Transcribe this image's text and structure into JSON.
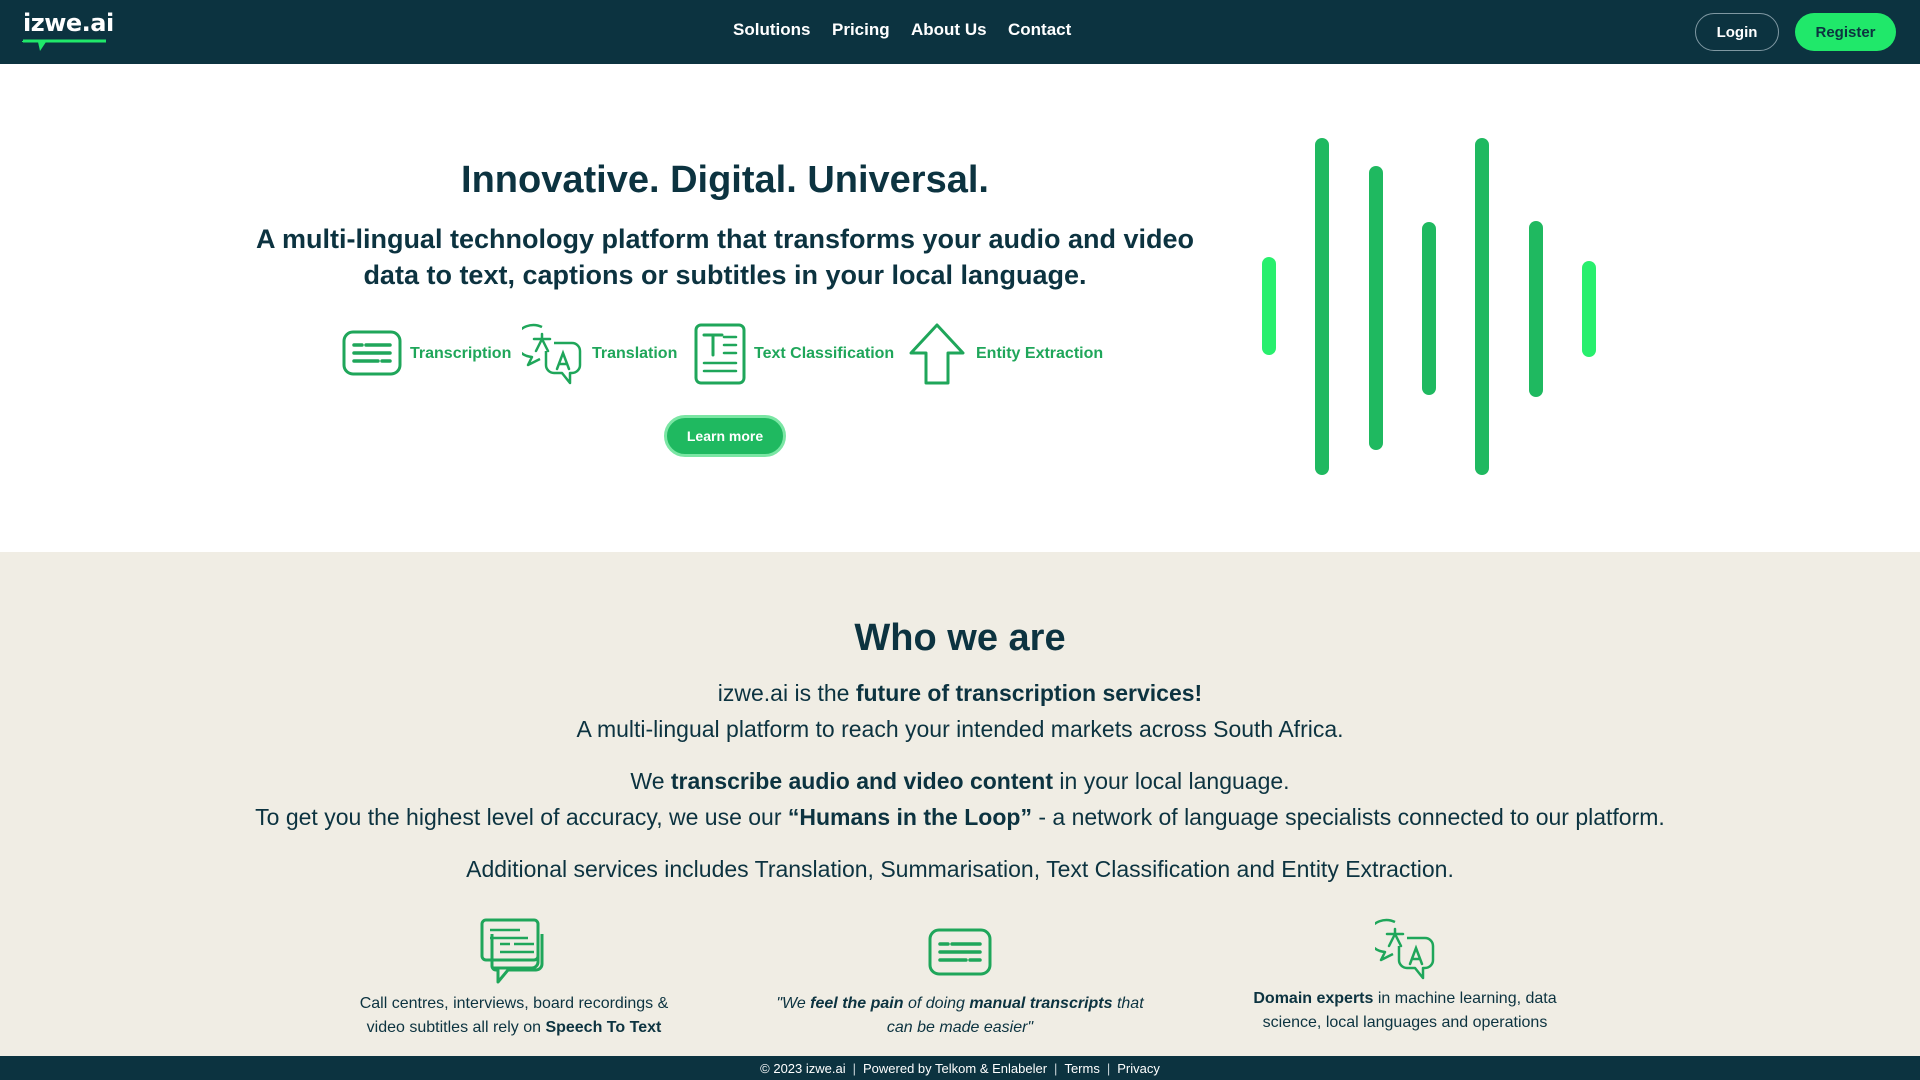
{
  "brand": {
    "logo_text": "izwe.ai",
    "accent": "#20e86a",
    "dark": "#0c3340"
  },
  "nav": {
    "solutions": "Solutions",
    "pricing": "Pricing",
    "about": "About Us",
    "contact": "Contact"
  },
  "auth": {
    "login": "Login",
    "register": "Register"
  },
  "hero": {
    "title": "Innovative. Digital. Universal.",
    "subtitle_line1": "A multi-lingual technology platform that transforms your audio and video",
    "subtitle_line2": "data to text, captions or subtitles in your local language.",
    "features": {
      "transcription": "Transcription",
      "translation": "Translation",
      "text_classification": "Text Classification",
      "entity_extraction": "Entity Extraction"
    },
    "learn_more": "Learn more"
  },
  "who": {
    "title": "Who we are",
    "p1a": "izwe.ai is the ",
    "p1b": "future of transcription services!",
    "p2": "A multi-lingual platform to reach your intended markets across South Africa.",
    "p3a": "We ",
    "p3b": "transcribe audio and video content",
    "p3c": " in your local language.",
    "p4a": "To get you the highest level of accuracy, we use our ",
    "p4b": "“Humans in the Loop”",
    "p4c": " - a network of language specialists connected to our platform.",
    "p5": "Additional services includes Translation, Summarisation, Text Classification and Entity Extraction.",
    "card1": {
      "line1": "Call centres, interviews, board recordings &",
      "line2a": "video subtitles all rely on ",
      "line2b": "Speech To Text"
    },
    "card2": {
      "q1a": "\"We ",
      "q1b": "feel the pain",
      "q1c": " of doing ",
      "q1d": "manual transcripts",
      "q1e": " that",
      "q2": "can be made easier\""
    },
    "card3": {
      "line1a": "Domain experts",
      "line1b": " in machine learning, data",
      "line2": "science, local languages and operations"
    }
  },
  "footer": {
    "copyright": "© 2023 izwe.ai",
    "powered": "Powered by Telkom & Enlabeler",
    "terms": "Terms",
    "privacy": "Privacy"
  }
}
